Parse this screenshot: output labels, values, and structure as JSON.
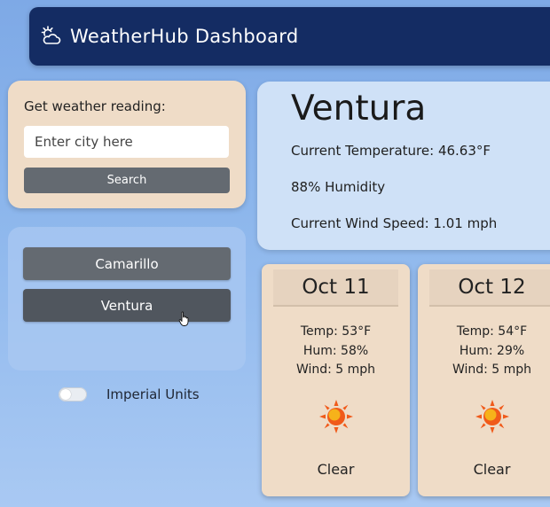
{
  "header": {
    "title": "WeatherHub Dashboard",
    "icon": "cloud-sun-icon",
    "background": "#142c63"
  },
  "search": {
    "label": "Get weather reading:",
    "placeholder": "Enter city here",
    "value": "",
    "button_label": "Search"
  },
  "cities": [
    {
      "label": "Camarillo"
    },
    {
      "label": "Ventura"
    }
  ],
  "units": {
    "label": "Imperial Units",
    "toggle_on": false
  },
  "current": {
    "city": "Ventura",
    "temperature": "Current Temperature: 46.63°F",
    "humidity": "88% Humidity",
    "wind": "Current Wind Speed: 1.01 mph"
  },
  "forecast": [
    {
      "date": "Oct 11",
      "temp": "Temp: 53°F",
      "hum": "Hum: 58%",
      "wind": "Wind: 5 mph",
      "icon": "sun-icon",
      "condition": "Clear"
    },
    {
      "date": "Oct 12",
      "temp": "Temp: 54°F",
      "hum": "Hum: 29%",
      "wind": "Wind: 5 mph",
      "icon": "sun-icon",
      "condition": "Clear"
    }
  ],
  "colors": {
    "button_gray": "#646a71",
    "button_active": "#50565e",
    "card_beige": "#efdcc7",
    "card_blue": "#cfe1f7",
    "sun_orange": "#f05a1a",
    "sun_yellow": "#f7c21b"
  }
}
